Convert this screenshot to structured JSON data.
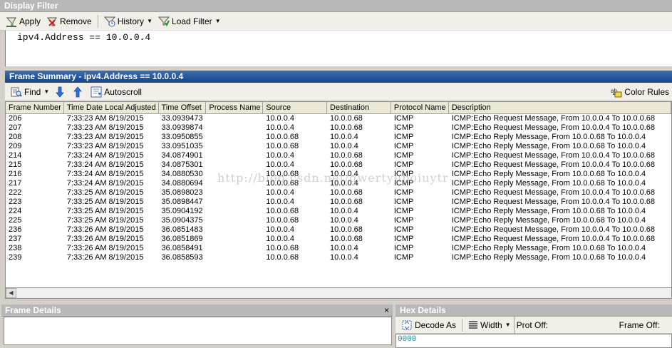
{
  "display_filter": {
    "title": "Display Filter",
    "toolbar": {
      "apply": "Apply",
      "remove": "Remove",
      "history": "History",
      "load_filter": "Load Filter"
    },
    "expression": "ipv4.Address == 10.0.0.4"
  },
  "frame_summary": {
    "title": "Frame Summary - ipv4.Address == 10.0.0.4",
    "toolbar": {
      "find": "Find",
      "autoscroll": "Autoscroll",
      "color_rules": "Color Rules"
    },
    "columns": [
      "Frame Number",
      "Time Date Local Adjusted",
      "Time Offset",
      "Process Name",
      "Source",
      "Destination",
      "Protocol Name",
      "Description"
    ],
    "rows": [
      [
        "206",
        "7:33:23 AM 8/19/2015",
        "33.0939473",
        "",
        "10.0.0.4",
        "10.0.0.68",
        "ICMP",
        "ICMP:Echo Request Message, From 10.0.0.4 To 10.0.0.68"
      ],
      [
        "207",
        "7:33:23 AM 8/19/2015",
        "33.0939874",
        "",
        "10.0.0.4",
        "10.0.0.68",
        "ICMP",
        "ICMP:Echo Request Message, From 10.0.0.4 To 10.0.0.68"
      ],
      [
        "208",
        "7:33:23 AM 8/19/2015",
        "33.0950855",
        "",
        "10.0.0.68",
        "10.0.0.4",
        "ICMP",
        "ICMP:Echo Reply Message, From 10.0.0.68 To 10.0.0.4"
      ],
      [
        "209",
        "7:33:23 AM 8/19/2015",
        "33.0951035",
        "",
        "10.0.0.68",
        "10.0.0.4",
        "ICMP",
        "ICMP:Echo Reply Message, From 10.0.0.68 To 10.0.0.4"
      ],
      [
        "214",
        "7:33:24 AM 8/19/2015",
        "34.0874901",
        "",
        "10.0.0.4",
        "10.0.0.68",
        "ICMP",
        "ICMP:Echo Request Message, From 10.0.0.4 To 10.0.0.68"
      ],
      [
        "215",
        "7:33:24 AM 8/19/2015",
        "34.0875301",
        "",
        "10.0.0.4",
        "10.0.0.68",
        "ICMP",
        "ICMP:Echo Request Message, From 10.0.0.4 To 10.0.0.68"
      ],
      [
        "216",
        "7:33:24 AM 8/19/2015",
        "34.0880530",
        "",
        "10.0.0.68",
        "10.0.0.4",
        "ICMP",
        "ICMP:Echo Reply Message, From 10.0.0.68 To 10.0.0.4"
      ],
      [
        "217",
        "7:33:24 AM 8/19/2015",
        "34.0880694",
        "",
        "10.0.0.68",
        "10.0.0.4",
        "ICMP",
        "ICMP:Echo Reply Message, From 10.0.0.68 To 10.0.0.4"
      ],
      [
        "222",
        "7:33:25 AM 8/19/2015",
        "35.0898023",
        "",
        "10.0.0.4",
        "10.0.0.68",
        "ICMP",
        "ICMP:Echo Request Message, From 10.0.0.4 To 10.0.0.68"
      ],
      [
        "223",
        "7:33:25 AM 8/19/2015",
        "35.0898447",
        "",
        "10.0.0.4",
        "10.0.0.68",
        "ICMP",
        "ICMP:Echo Request Message, From 10.0.0.4 To 10.0.0.68"
      ],
      [
        "224",
        "7:33:25 AM 8/19/2015",
        "35.0904192",
        "",
        "10.0.0.68",
        "10.0.0.4",
        "ICMP",
        "ICMP:Echo Reply Message, From 10.0.0.68 To 10.0.0.4"
      ],
      [
        "225",
        "7:33:25 AM 8/19/2015",
        "35.0904375",
        "",
        "10.0.0.68",
        "10.0.0.4",
        "ICMP",
        "ICMP:Echo Reply Message, From 10.0.0.68 To 10.0.0.4"
      ],
      [
        "236",
        "7:33:26 AM 8/19/2015",
        "36.0851483",
        "",
        "10.0.0.4",
        "10.0.0.68",
        "ICMP",
        "ICMP:Echo Request Message, From 10.0.0.4 To 10.0.0.68"
      ],
      [
        "237",
        "7:33:26 AM 8/19/2015",
        "36.0851869",
        "",
        "10.0.0.4",
        "10.0.0.68",
        "ICMP",
        "ICMP:Echo Request Message, From 10.0.0.4 To 10.0.0.68"
      ],
      [
        "238",
        "7:33:26 AM 8/19/2015",
        "36.0858491",
        "",
        "10.0.0.68",
        "10.0.0.4",
        "ICMP",
        "ICMP:Echo Reply Message, From 10.0.0.68 To 10.0.0.4"
      ],
      [
        "239",
        "7:33:26 AM 8/19/2015",
        "36.0858593",
        "",
        "10.0.0.68",
        "10.0.0.4",
        "ICMP",
        "ICMP:Echo Reply Message, From 10.0.0.68 To 10.0.0.4"
      ]
    ]
  },
  "frame_details": {
    "title": "Frame Details",
    "close": "×"
  },
  "hex_details": {
    "title": "Hex Details",
    "decode_as": "Decode As",
    "width": "Width",
    "prot_off": "Prot Off:",
    "frame_off": "Frame Off:",
    "offset": "0000"
  },
  "watermark": "http://blog.csdn.net/qwertyupoiuytr"
}
